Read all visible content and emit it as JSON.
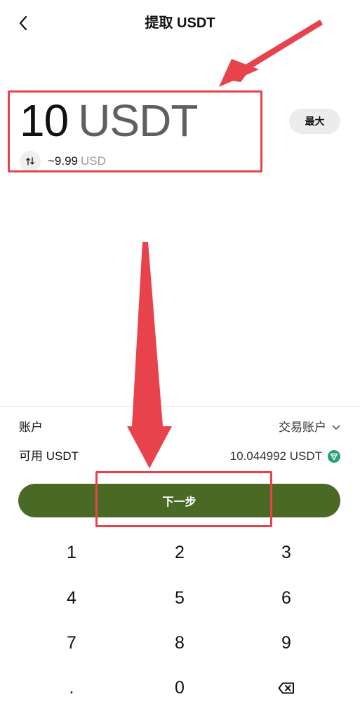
{
  "header": {
    "title": "提取 USDT",
    "back_icon": "chevron-left-icon"
  },
  "amount": {
    "value": "10",
    "currency": "USDT"
  },
  "conversion": {
    "approx": "~9.99",
    "currency": "USD",
    "swap_icon": "swap-arrows-icon"
  },
  "max_label": "最大",
  "account": {
    "label": "账户",
    "value": "交易账户",
    "dropdown_icon": "chevron-down-icon"
  },
  "available": {
    "label": "可用 USDT",
    "value": "10.044992 USDT",
    "token_icon": "tether-icon"
  },
  "next_label": "下一步",
  "keypad": {
    "keys": [
      "1",
      "2",
      "3",
      "4",
      "5",
      "6",
      "7",
      "8",
      "9",
      ".",
      "0"
    ],
    "backspace_icon": "backspace-icon"
  },
  "colors": {
    "primary": "#4a6925",
    "annotation": "#e8424c",
    "token": "#26a17b"
  }
}
